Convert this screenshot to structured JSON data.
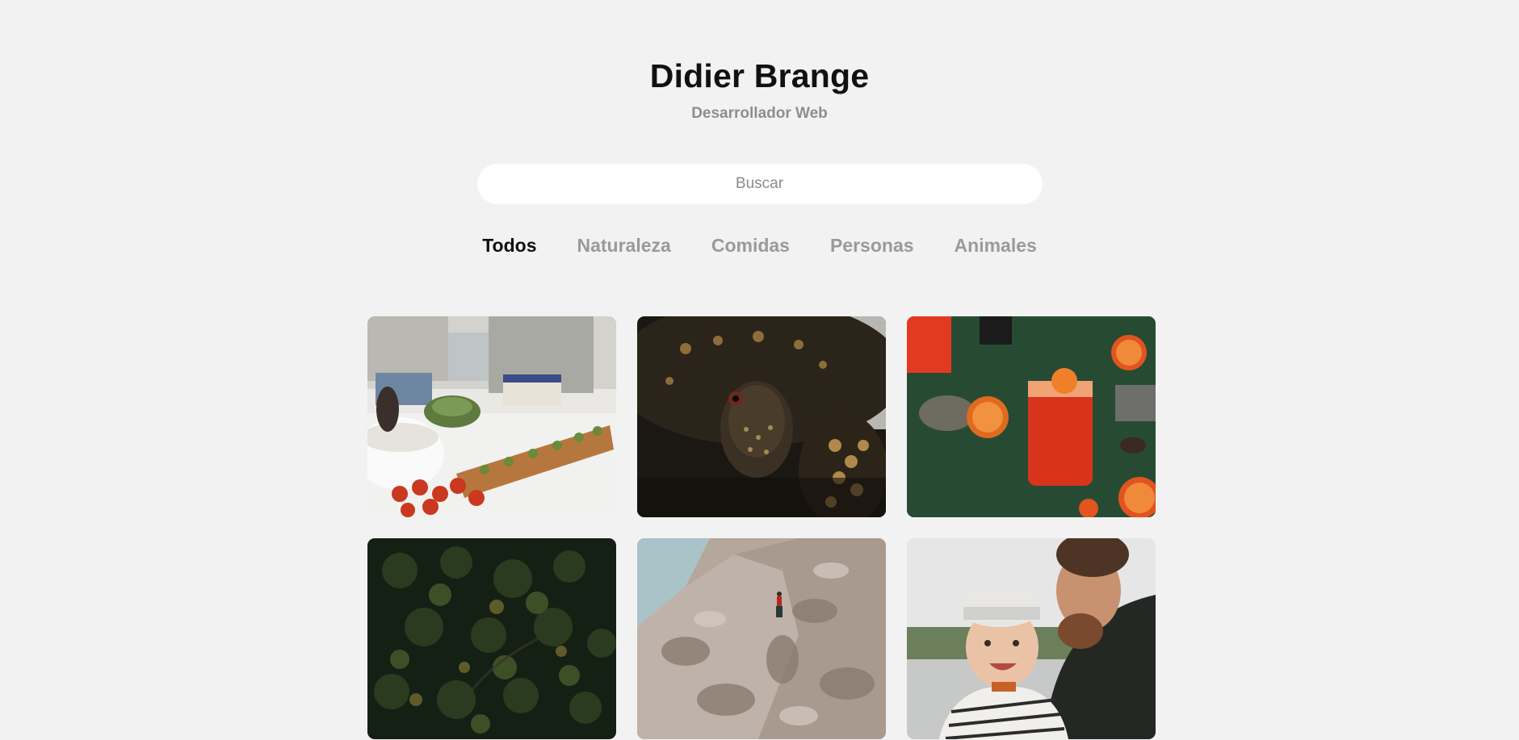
{
  "header": {
    "title": "Didier Brange",
    "subtitle": "Desarrollador Web"
  },
  "search": {
    "placeholder": "Buscar",
    "value": ""
  },
  "filters": {
    "active": "Todos",
    "items": [
      "Todos",
      "Naturaleza",
      "Comidas",
      "Personas",
      "Animales"
    ]
  },
  "gallery": {
    "items": [
      {
        "subject": "cooking-crackers-tomatoes",
        "category": "Comidas"
      },
      {
        "subject": "turtle-closeup",
        "category": "Animales"
      },
      {
        "subject": "blood-orange-cocktail",
        "category": "Comidas"
      },
      {
        "subject": "aerial-pine-forest",
        "category": "Naturaleza"
      },
      {
        "subject": "rock-climber-cliff",
        "category": "Naturaleza"
      },
      {
        "subject": "father-and-baby",
        "category": "Personas"
      }
    ]
  }
}
